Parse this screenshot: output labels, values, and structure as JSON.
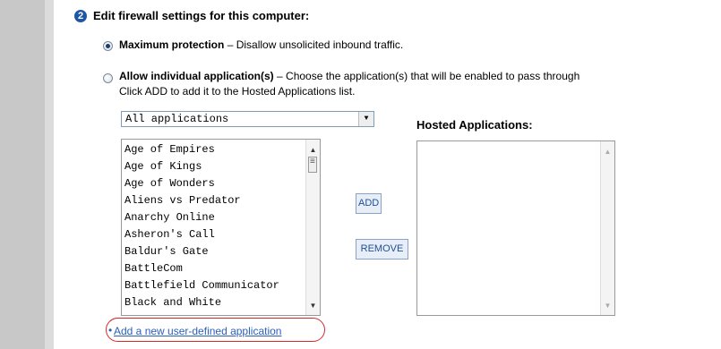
{
  "step": {
    "number": "2",
    "title": "Edit firewall settings for this computer:"
  },
  "options": {
    "max": {
      "bold": "Maximum protection",
      "rest": " – Disallow unsolicited inbound traffic."
    },
    "allow": {
      "bold": "Allow individual application(s)",
      "rest": " – Choose the application(s) that will be enabled to pass through",
      "line2": "Click ADD to add it to the Hosted Applications list."
    }
  },
  "filter": {
    "selected": "All applications"
  },
  "apps": [
    "Age of Empires",
    "Age of Kings",
    "Age of Wonders",
    "Aliens vs Predator",
    "Anarchy Online",
    "Asheron's Call",
    "Baldur's Gate",
    "BattleCom",
    "Battlefield Communicator",
    "Black and White"
  ],
  "buttons": {
    "add": "ADD",
    "remove": "REMOVE"
  },
  "hosted": {
    "title": "Hosted Applications:"
  },
  "link": {
    "text": "Add a new user-defined application",
    "bullet": "•"
  },
  "colors": {
    "accent": "#1d56a7",
    "link": "#2c5fb8",
    "highlight_ring": "#d42a2a"
  }
}
